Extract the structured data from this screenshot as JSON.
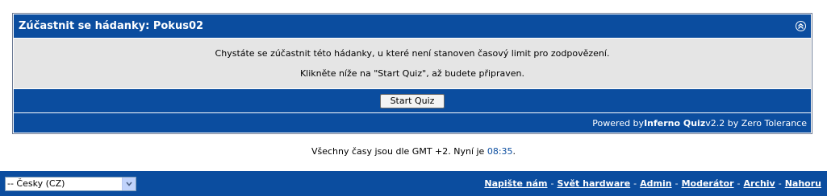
{
  "quiz": {
    "title": "Zúčastnit se hádanky: Pokus02",
    "collapse_glyph": "⌃",
    "message_line1": "Chystáte se zúčastnit této hádanky, u které není stanoven časový limit pro zodpovězení.",
    "message_line2": "Klikněte níže na \"Start Quiz\", až budete připraven.",
    "start_button": "Start Quiz",
    "footer_prefix": "Powered by ",
    "footer_brand": "Inferno Quiz",
    "footer_suffix": " v2.2 by Zero Tolerance"
  },
  "timezone": {
    "text": "Všechny časy jsou dle GMT +2. Nyní je ",
    "time": "08:35",
    "suffix": "."
  },
  "language_select": {
    "value": "-- Česky (CZ)",
    "arrow_icon": "chevron-down-icon"
  },
  "nav_links": [
    {
      "label": "Napište nám"
    },
    {
      "label": "Svět hardware"
    },
    {
      "label": "Admin"
    },
    {
      "label": "Moderátor"
    },
    {
      "label": "Archiv"
    },
    {
      "label": "Nahoru"
    }
  ],
  "nav_separator": "-",
  "colors": {
    "brand_blue": "#0b4d9f",
    "panel_gray": "#e5e5e5",
    "frame": "#6d7b95"
  }
}
